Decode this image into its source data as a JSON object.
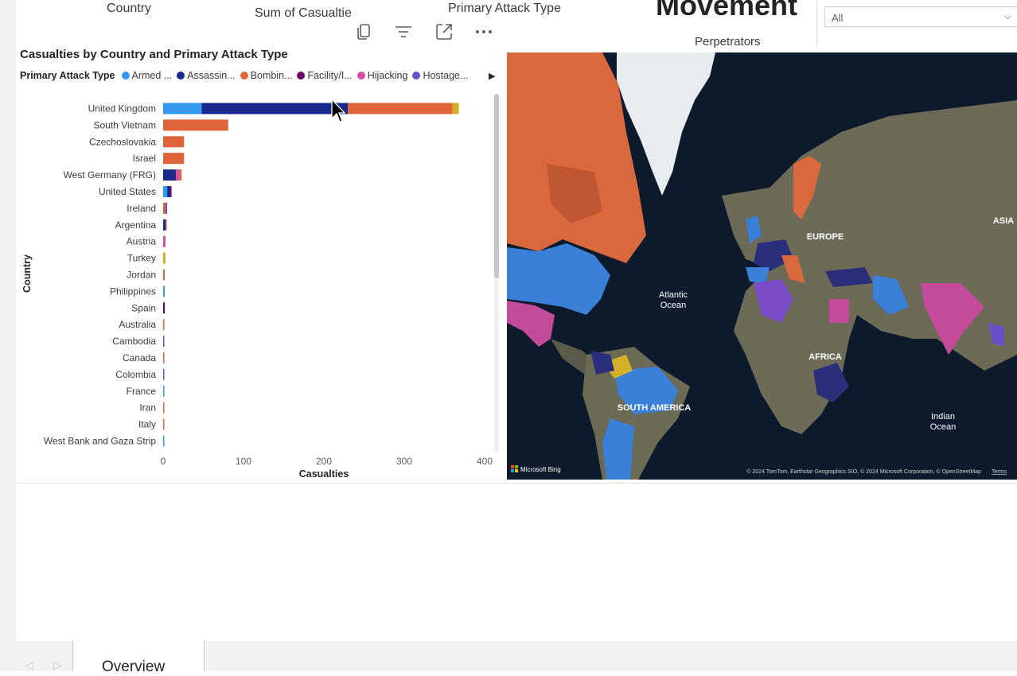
{
  "header": {
    "field_country": "Country",
    "field_sum_casualties": "Sum of Casualtie",
    "field_attack_type": "Primary Attack Type",
    "big_title": "Movement",
    "perpetrators": "Perpetrators",
    "slicer_value": "All"
  },
  "toolbar": {
    "icons": [
      "copy-icon",
      "filter-icon",
      "focus-mode-icon",
      "more-options-icon"
    ]
  },
  "visual": {
    "title": "Casualties by Country and Primary Attack Type",
    "legend_title": "Primary Attack Type",
    "legend_items": [
      {
        "label": "Armed ...",
        "color": "#3399f0"
      },
      {
        "label": "Assassin...",
        "color": "#1a2a8c"
      },
      {
        "label": "Bombin...",
        "color": "#e0643a"
      },
      {
        "label": "Facility/I...",
        "color": "#6b0066"
      },
      {
        "label": "Hijacking",
        "color": "#d94aa8"
      },
      {
        "label": "Hostage...",
        "color": "#6a4fc8"
      }
    ]
  },
  "chart_data": {
    "type": "bar",
    "orientation": "horizontal",
    "stacked": true,
    "title": "Casualties by Country and Primary Attack Type",
    "xlabel": "Casualties",
    "ylabel": "Country",
    "xlim": [
      0,
      400
    ],
    "xticks": [
      "0",
      "100",
      "200",
      "300",
      "400"
    ],
    "categories": [
      "United Kingdom",
      "South Vietnam",
      "Czechoslovakia",
      "Israel",
      "West Germany (FRG)",
      "United States",
      "Ireland",
      "Argentina",
      "Austria",
      "Turkey",
      "Jordan",
      "Philippines",
      "Spain",
      "Australia",
      "Cambodia",
      "Canada",
      "Colombia",
      "France",
      "Iran",
      "Italy",
      "West Bank and Gaza Strip"
    ],
    "segments": [
      [
        {
          "color": "#3399f0",
          "value": 48
        },
        {
          "color": "#1a2a8c",
          "value": 182
        },
        {
          "color": "#e0643a",
          "value": 130
        },
        {
          "color": "#d4b028",
          "value": 8
        }
      ],
      [
        {
          "color": "#e0643a",
          "value": 81
        }
      ],
      [
        {
          "color": "#e0643a",
          "value": 26
        }
      ],
      [
        {
          "color": "#e0643a",
          "value": 26
        }
      ],
      [
        {
          "color": "#1a2a8c",
          "value": 16
        },
        {
          "color": "#d94aa8",
          "value": 4
        },
        {
          "color": "#e0643a",
          "value": 3
        }
      ],
      [
        {
          "color": "#3399f0",
          "value": 5
        },
        {
          "color": "#1a2a8c",
          "value": 4
        },
        {
          "color": "#6b0066",
          "value": 1
        }
      ],
      [
        {
          "color": "#e0643a",
          "value": 3
        },
        {
          "color": "#6a4fc8",
          "value": 2
        }
      ],
      [
        {
          "color": "#1a2a8c",
          "value": 3
        },
        {
          "color": "#e0643a",
          "value": 1
        }
      ],
      [
        {
          "color": "#d94aa8",
          "value": 3
        }
      ],
      [
        {
          "color": "#d4b028",
          "value": 3
        }
      ],
      [
        {
          "color": "#e0643a",
          "value": 2
        }
      ],
      [
        {
          "color": "#3399f0",
          "value": 2
        }
      ],
      [
        {
          "color": "#6b0066",
          "value": 2
        }
      ],
      [
        {
          "color": "#e0643a",
          "value": 1
        }
      ],
      [
        {
          "color": "#6a4fc8",
          "value": 1
        }
      ],
      [
        {
          "color": "#e0643a",
          "value": 1
        }
      ],
      [
        {
          "color": "#6a4fc8",
          "value": 1
        }
      ],
      [
        {
          "color": "#3399f0",
          "value": 1
        }
      ],
      [
        {
          "color": "#e0643a",
          "value": 1
        }
      ],
      [
        {
          "color": "#e0643a",
          "value": 1
        }
      ],
      [
        {
          "color": "#3399f0",
          "value": 1
        }
      ]
    ],
    "legend_position": "top",
    "grid": false
  },
  "map": {
    "labels": {
      "europe": "EUROPE",
      "asia": "ASIA",
      "atlantic_ocean": "Atlantic\nOcean",
      "africa": "AFRICA",
      "south_america": "SOUTH AMERICA",
      "indian_ocean": "Indian\nOcean"
    },
    "brand": "Microsoft Bing",
    "copyright": "© 2024 TomTom, Earthstar Geographics SIO, © 2024 Microsoft Corporation, © OpenStreetMap",
    "terms": "Terms"
  },
  "tabs": {
    "active": "Overview"
  }
}
